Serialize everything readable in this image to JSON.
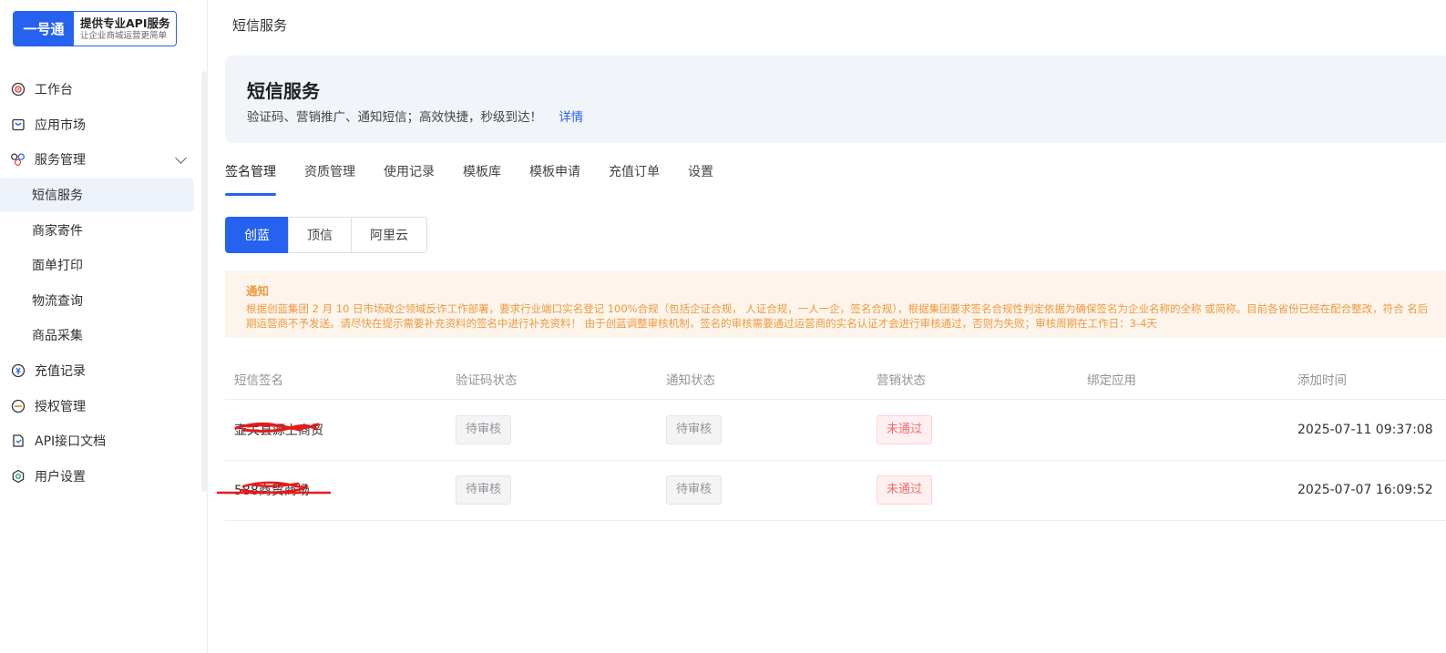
{
  "logo": {
    "brand": "一号通",
    "title": "提供专业API服务",
    "subtitle": "让企业商城运营更简单"
  },
  "sidebar": {
    "items": [
      {
        "label": "工作台",
        "icon": "target-icon"
      },
      {
        "label": "应用市场",
        "icon": "store-icon"
      },
      {
        "label": "服务管理",
        "icon": "apps-icon",
        "expanded": true
      },
      {
        "label": "短信服务",
        "sub": true,
        "active": true
      },
      {
        "label": "商家寄件",
        "sub": true
      },
      {
        "label": "面单打印",
        "sub": true
      },
      {
        "label": "物流查询",
        "sub": true
      },
      {
        "label": "商品采集",
        "sub": true
      },
      {
        "label": "充值记录",
        "icon": "recharge-icon"
      },
      {
        "label": "授权管理",
        "icon": "auth-icon"
      },
      {
        "label": "API接口文档",
        "icon": "doc-icon"
      },
      {
        "label": "用户设置",
        "icon": "settings-icon"
      }
    ]
  },
  "breadcrumb": "短信服务",
  "banner": {
    "title": "短信服务",
    "desc": "验证码、营销推广、通知短信；高效快捷，秒级到达！",
    "link": "详情"
  },
  "tabs": [
    "签名管理",
    "资质管理",
    "使用记录",
    "模板库",
    "模板申请",
    "充值订单",
    "设置"
  ],
  "providers": [
    "创蓝",
    "顶信",
    "阿里云"
  ],
  "notice": {
    "title": "通知",
    "body": "根据创蓝集团 2 月 10 日市场政企领域反诈工作部署，要求行业端口实名登记 100%合规（包括企证合规， 人证合规，一人一企，签名合规），根据集团要求签名合规性判定依据为确保签名为企业名称的全称 或简称。目前各省份已经在配合整改，符合 名后期运营商不予发送。请尽快在提示需要补充资料的签名中进行补充资料！ 由于创蓝调整审核机制，签名的审核需要通过运营商的实名认证才会进行审核通过，否则为失败；审核周期在工作日：3-4天"
  },
  "table": {
    "headers": [
      "短信签名",
      "验证码状态",
      "通知状态",
      "营销状态",
      "绑定应用",
      "添加时间"
    ],
    "rows": [
      {
        "signature": "壶关县源上商贸",
        "code_status": "待审核",
        "notice_status": "待审核",
        "marketing_status": "未通过",
        "app": "",
        "added": "2025-07-11 09:37:08"
      },
      {
        "signature": "588商贸商场",
        "code_status": "待审核",
        "notice_status": "待审核",
        "marketing_status": "未通过",
        "app": "",
        "added": "2025-07-07 16:09:52"
      }
    ]
  },
  "colors": {
    "primary": "#2662f0",
    "warning": "#f0993e",
    "danger": "#f56c6c"
  }
}
